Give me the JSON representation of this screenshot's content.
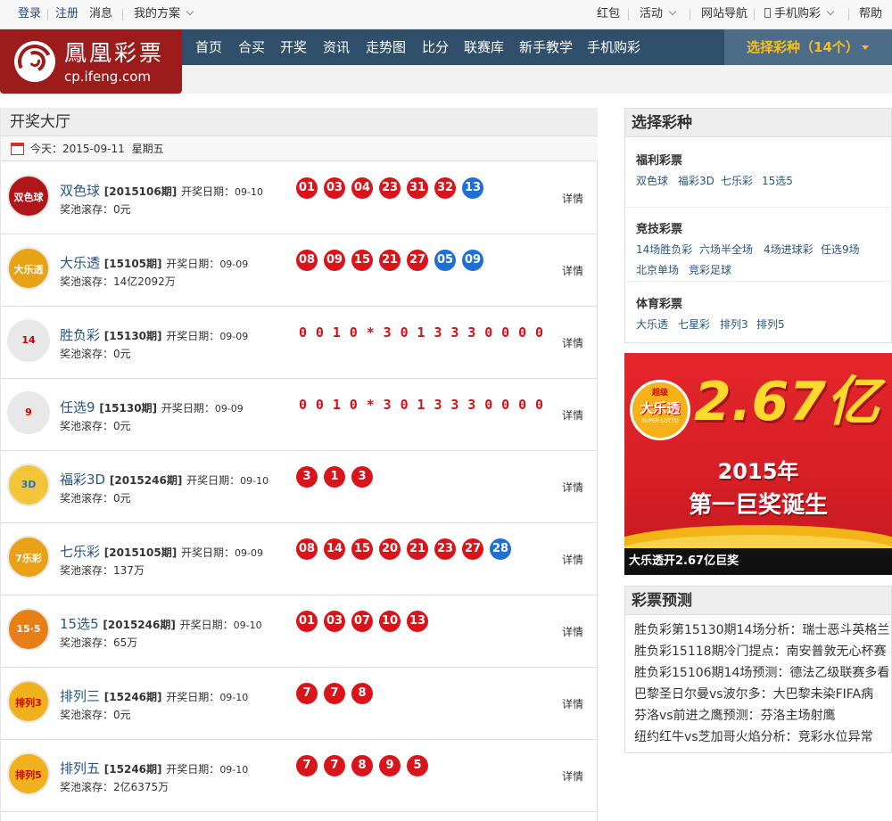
{
  "topbar": {
    "login": "登录",
    "register": "注册",
    "messages": "消息",
    "my_plan": "我的方案",
    "red_packet": "红包",
    "activity": "活动",
    "site_nav": "网站导航",
    "mobile_lottery": "手机购彩",
    "help": "帮助"
  },
  "logo": {
    "cn": "鳳凰彩票",
    "en": "cp.ifeng.com"
  },
  "nav": {
    "items": [
      "首页",
      "合买",
      "开奖",
      "资讯",
      "走势图",
      "比分",
      "联赛库",
      "新手教学",
      "手机购彩"
    ],
    "select_lottery": "选择彩种（14个）"
  },
  "main": {
    "title": "开奖大厅",
    "today_label": "今天：",
    "today_date": "2015-09-11",
    "today_weekday": "星期五",
    "rows": [
      {
        "name": "双色球",
        "issue": "[2015106期]",
        "date_label": "开奖日期：",
        "date": "09-10",
        "pool": "奖池滚存：0元",
        "balls": [
          "01",
          "03",
          "04",
          "23",
          "31",
          "32"
        ],
        "blue_balls": [
          "13"
        ],
        "detail": "详情",
        "badge": "双色球"
      },
      {
        "name": "大乐透",
        "issue": "[15105期]",
        "date_label": "开奖日期：",
        "date": "09-09",
        "pool": "奖池滚存：14亿2092万",
        "balls": [
          "08",
          "09",
          "15",
          "21",
          "27"
        ],
        "blue_balls": [
          "05",
          "09"
        ],
        "detail": "详情",
        "badge": "大乐透"
      },
      {
        "name": "胜负彩",
        "issue": "[15130期]",
        "date_label": "开奖日期：",
        "date": "09-09",
        "pool": "奖池滚存：0元",
        "digits": "0010*3013330000",
        "detail": "详情",
        "badge": "14"
      },
      {
        "name": "任选9",
        "issue": "[15130期]",
        "date_label": "开奖日期：",
        "date": "09-09",
        "pool": "奖池滚存：0元",
        "digits": "0010*3013330000",
        "detail": "详情",
        "badge": "9"
      },
      {
        "name": "福彩3D",
        "issue": "[2015246期]",
        "date_label": "开奖日期：",
        "date": "09-10",
        "pool": "奖池滚存：0元",
        "balls": [
          "3",
          "1",
          "3"
        ],
        "blue_balls": [],
        "detail": "详情",
        "badge": "3D"
      },
      {
        "name": "七乐彩",
        "issue": "[2015105期]",
        "date_label": "开奖日期：",
        "date": "09-09",
        "pool": "奖池滚存：137万",
        "balls": [
          "08",
          "14",
          "15",
          "20",
          "21",
          "23",
          "27"
        ],
        "blue_balls": [
          "28"
        ],
        "detail": "详情",
        "badge": "7乐彩"
      },
      {
        "name": "15选5",
        "issue": "[2015246期]",
        "date_label": "开奖日期：",
        "date": "09-10",
        "pool": "奖池滚存：65万",
        "balls": [
          "01",
          "03",
          "07",
          "10",
          "13"
        ],
        "blue_balls": [],
        "detail": "详情",
        "badge": "15·5"
      },
      {
        "name": "排列三",
        "issue": "[15246期]",
        "date_label": "开奖日期：",
        "date": "09-10",
        "pool": "奖池滚存：0元",
        "balls": [
          "7",
          "7",
          "8"
        ],
        "blue_balls": [],
        "detail": "详情",
        "badge": "排列3"
      },
      {
        "name": "排列五",
        "issue": "[15246期]",
        "date_label": "开奖日期：",
        "date": "09-10",
        "pool": "奖池滚存：2亿6375万",
        "balls": [
          "7",
          "7",
          "8",
          "9",
          "5"
        ],
        "blue_balls": [],
        "detail": "详情",
        "badge": "排列5"
      }
    ]
  },
  "sidebar": {
    "select_title": "选择彩种",
    "groups": [
      {
        "title": "福利彩票",
        "links": [
          "双色球",
          "福彩3D",
          "七乐彩",
          "15选5"
        ]
      },
      {
        "title": "竞技彩票",
        "links": [
          "14场胜负彩",
          "六场半全场",
          "4场进球彩",
          "任选9场",
          "北京单场",
          "竞彩足球"
        ]
      },
      {
        "title": "体育彩票",
        "links": [
          "大乐透",
          "七星彩",
          "排列3",
          "排列5"
        ]
      }
    ],
    "banner": {
      "badge_top": "超级",
      "badge_main": "大乐透",
      "badge_sub": "SUPER LOTTO",
      "amount": "2.67亿",
      "year": "2015年",
      "slogan": "第一巨奖诞生",
      "caption": "大乐透开2.67亿巨奖"
    },
    "forecast_title": "彩票预测",
    "forecasts": [
      "胜负彩第15130期14场分析：瑞士恶斗英格兰",
      "胜负彩15118期冷门提点：南安普敦无心杯赛",
      "胜负彩15106期14场预测：德法乙级联赛多看",
      "巴黎圣日尔曼vs波尔多：大巴黎未染FIFA病",
      "芬洛vs前进之鹰预测：芬洛主场射鹰",
      "纽约红牛vs芝加哥火焰分析：竞彩水位异常"
    ]
  },
  "colors": {
    "brand_red": "#9c1b1b",
    "nav_blue": "#2f4f6b",
    "ball_red": "#d9141a",
    "ball_blue": "#1e6fd6",
    "select_gold": "#f4c01b"
  },
  "icons": [
    "calendar-icon",
    "phone-icon",
    "chevron-down-icon",
    "caret-down-icon"
  ]
}
